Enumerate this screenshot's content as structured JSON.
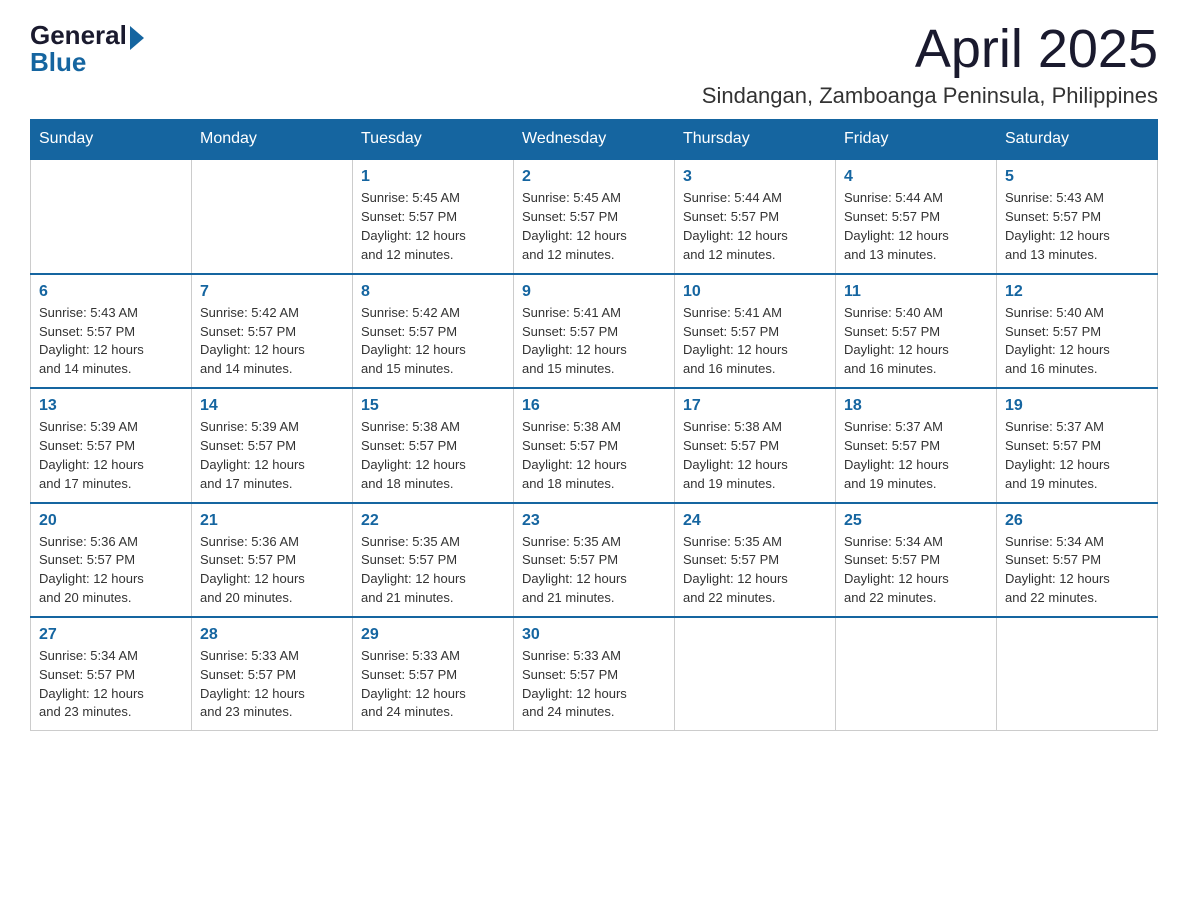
{
  "logo": {
    "general": "General",
    "blue": "Blue"
  },
  "title": "April 2025",
  "location": "Sindangan, Zamboanga Peninsula, Philippines",
  "days_of_week": [
    "Sunday",
    "Monday",
    "Tuesday",
    "Wednesday",
    "Thursday",
    "Friday",
    "Saturday"
  ],
  "weeks": [
    [
      {
        "day": "",
        "info": ""
      },
      {
        "day": "",
        "info": ""
      },
      {
        "day": "1",
        "info": "Sunrise: 5:45 AM\nSunset: 5:57 PM\nDaylight: 12 hours\nand 12 minutes."
      },
      {
        "day": "2",
        "info": "Sunrise: 5:45 AM\nSunset: 5:57 PM\nDaylight: 12 hours\nand 12 minutes."
      },
      {
        "day": "3",
        "info": "Sunrise: 5:44 AM\nSunset: 5:57 PM\nDaylight: 12 hours\nand 12 minutes."
      },
      {
        "day": "4",
        "info": "Sunrise: 5:44 AM\nSunset: 5:57 PM\nDaylight: 12 hours\nand 13 minutes."
      },
      {
        "day": "5",
        "info": "Sunrise: 5:43 AM\nSunset: 5:57 PM\nDaylight: 12 hours\nand 13 minutes."
      }
    ],
    [
      {
        "day": "6",
        "info": "Sunrise: 5:43 AM\nSunset: 5:57 PM\nDaylight: 12 hours\nand 14 minutes."
      },
      {
        "day": "7",
        "info": "Sunrise: 5:42 AM\nSunset: 5:57 PM\nDaylight: 12 hours\nand 14 minutes."
      },
      {
        "day": "8",
        "info": "Sunrise: 5:42 AM\nSunset: 5:57 PM\nDaylight: 12 hours\nand 15 minutes."
      },
      {
        "day": "9",
        "info": "Sunrise: 5:41 AM\nSunset: 5:57 PM\nDaylight: 12 hours\nand 15 minutes."
      },
      {
        "day": "10",
        "info": "Sunrise: 5:41 AM\nSunset: 5:57 PM\nDaylight: 12 hours\nand 16 minutes."
      },
      {
        "day": "11",
        "info": "Sunrise: 5:40 AM\nSunset: 5:57 PM\nDaylight: 12 hours\nand 16 minutes."
      },
      {
        "day": "12",
        "info": "Sunrise: 5:40 AM\nSunset: 5:57 PM\nDaylight: 12 hours\nand 16 minutes."
      }
    ],
    [
      {
        "day": "13",
        "info": "Sunrise: 5:39 AM\nSunset: 5:57 PM\nDaylight: 12 hours\nand 17 minutes."
      },
      {
        "day": "14",
        "info": "Sunrise: 5:39 AM\nSunset: 5:57 PM\nDaylight: 12 hours\nand 17 minutes."
      },
      {
        "day": "15",
        "info": "Sunrise: 5:38 AM\nSunset: 5:57 PM\nDaylight: 12 hours\nand 18 minutes."
      },
      {
        "day": "16",
        "info": "Sunrise: 5:38 AM\nSunset: 5:57 PM\nDaylight: 12 hours\nand 18 minutes."
      },
      {
        "day": "17",
        "info": "Sunrise: 5:38 AM\nSunset: 5:57 PM\nDaylight: 12 hours\nand 19 minutes."
      },
      {
        "day": "18",
        "info": "Sunrise: 5:37 AM\nSunset: 5:57 PM\nDaylight: 12 hours\nand 19 minutes."
      },
      {
        "day": "19",
        "info": "Sunrise: 5:37 AM\nSunset: 5:57 PM\nDaylight: 12 hours\nand 19 minutes."
      }
    ],
    [
      {
        "day": "20",
        "info": "Sunrise: 5:36 AM\nSunset: 5:57 PM\nDaylight: 12 hours\nand 20 minutes."
      },
      {
        "day": "21",
        "info": "Sunrise: 5:36 AM\nSunset: 5:57 PM\nDaylight: 12 hours\nand 20 minutes."
      },
      {
        "day": "22",
        "info": "Sunrise: 5:35 AM\nSunset: 5:57 PM\nDaylight: 12 hours\nand 21 minutes."
      },
      {
        "day": "23",
        "info": "Sunrise: 5:35 AM\nSunset: 5:57 PM\nDaylight: 12 hours\nand 21 minutes."
      },
      {
        "day": "24",
        "info": "Sunrise: 5:35 AM\nSunset: 5:57 PM\nDaylight: 12 hours\nand 22 minutes."
      },
      {
        "day": "25",
        "info": "Sunrise: 5:34 AM\nSunset: 5:57 PM\nDaylight: 12 hours\nand 22 minutes."
      },
      {
        "day": "26",
        "info": "Sunrise: 5:34 AM\nSunset: 5:57 PM\nDaylight: 12 hours\nand 22 minutes."
      }
    ],
    [
      {
        "day": "27",
        "info": "Sunrise: 5:34 AM\nSunset: 5:57 PM\nDaylight: 12 hours\nand 23 minutes."
      },
      {
        "day": "28",
        "info": "Sunrise: 5:33 AM\nSunset: 5:57 PM\nDaylight: 12 hours\nand 23 minutes."
      },
      {
        "day": "29",
        "info": "Sunrise: 5:33 AM\nSunset: 5:57 PM\nDaylight: 12 hours\nand 24 minutes."
      },
      {
        "day": "30",
        "info": "Sunrise: 5:33 AM\nSunset: 5:57 PM\nDaylight: 12 hours\nand 24 minutes."
      },
      {
        "day": "",
        "info": ""
      },
      {
        "day": "",
        "info": ""
      },
      {
        "day": "",
        "info": ""
      }
    ]
  ]
}
